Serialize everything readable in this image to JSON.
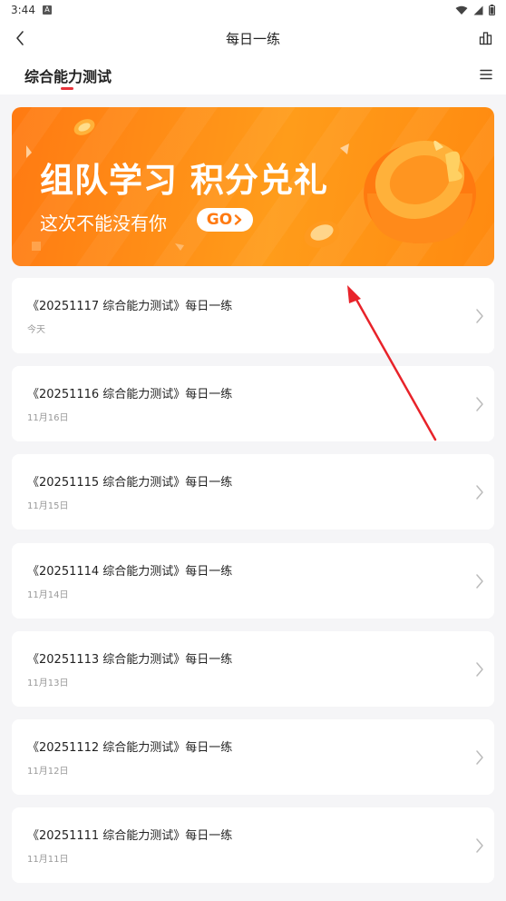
{
  "status_bar": {
    "time": "3:44",
    "notification_badge": "A"
  },
  "header": {
    "title": "每日一练",
    "back_icon": "chevron-left-icon",
    "stats_icon": "bar-chart-icon"
  },
  "tabs": {
    "active_label": "综合能力测试",
    "accent_color": "#e8333a",
    "menu_icon": "menu-icon"
  },
  "banner": {
    "headline": "组队学习 积分兑礼",
    "subtitle": "这次不能没有你",
    "button": "GO",
    "color_start": "#ff7a12",
    "color_end": "#ff9c1a"
  },
  "list": [
    {
      "title": "《20251117 综合能力测试》每日一练",
      "date": "今天"
    },
    {
      "title": "《20251116 综合能力测试》每日一练",
      "date": "11月16日"
    },
    {
      "title": "《20251115 综合能力测试》每日一练",
      "date": "11月15日"
    },
    {
      "title": "《20251114 综合能力测试》每日一练",
      "date": "11月14日"
    },
    {
      "title": "《20251113 综合能力测试》每日一练",
      "date": "11月13日"
    },
    {
      "title": "《20251112 综合能力测试》每日一练",
      "date": "11月12日"
    },
    {
      "title": "《20251111 综合能力测试》每日一练",
      "date": "11月11日"
    }
  ],
  "annotation_color": "#e8232a"
}
